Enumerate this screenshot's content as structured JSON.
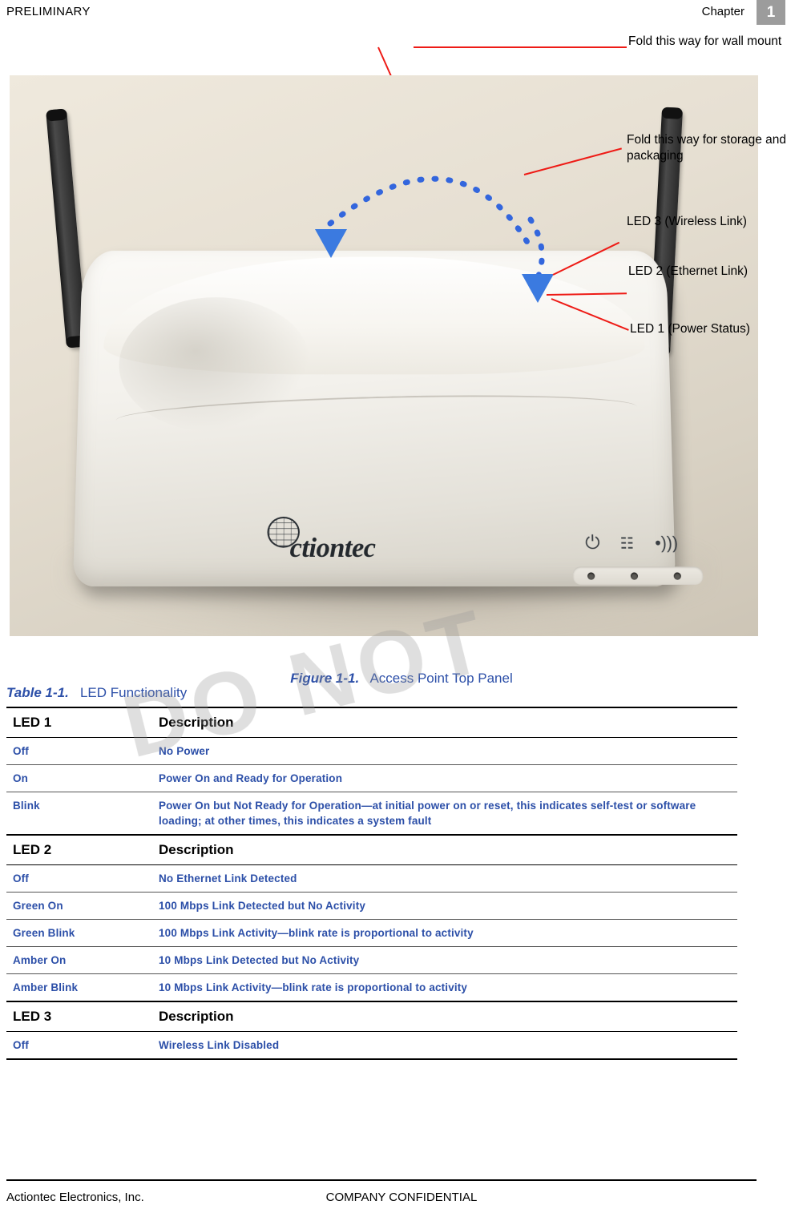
{
  "header": {
    "left_label": "PRELIMINARY",
    "chapter_label": "Chapter",
    "chapter_number": "1"
  },
  "figure": {
    "callouts": [
      {
        "id": "fold-wall",
        "text": "Fold this way for wall mount"
      },
      {
        "id": "fold-storage",
        "text": "Fold this way for storage and packaging"
      },
      {
        "id": "led3",
        "text": "LED 3 (Wireless Link)"
      },
      {
        "id": "led2",
        "text": "LED 2 (Ethernet Link)"
      },
      {
        "id": "led1",
        "text": "LED 1 (Power Status)"
      }
    ],
    "device_logo": "ctiontec",
    "icons": {
      "power": "power-icon",
      "ethernet": "ethernet-icon",
      "wireless": "wireless-icon"
    },
    "caption_label": "Figure 1-1.",
    "caption_text": "Access Point Top Panel"
  },
  "table": {
    "caption_label": "Table 1-1.",
    "caption_text": "LED Functionality",
    "sections": [
      {
        "header": [
          "LED 1",
          "Description"
        ],
        "rows": [
          [
            "Off",
            "No Power"
          ],
          [
            "On",
            "Power On and Ready for Operation"
          ],
          [
            "Blink",
            "Power On but Not Ready for Operation—at initial power on or reset, this indicates self-test or software loading; at other times, this indicates a system fault"
          ]
        ]
      },
      {
        "header": [
          "LED 2",
          "Description"
        ],
        "rows": [
          [
            "Off",
            "No Ethernet Link Detected"
          ],
          [
            "Green On",
            "100 Mbps Link Detected but No Activity"
          ],
          [
            "Green Blink",
            "100 Mbps Link Activity—blink rate is proportional to activity"
          ],
          [
            "Amber On",
            "10 Mbps Link Detected but No Activity"
          ],
          [
            "Amber Blink",
            "10 Mbps Link Activity—blink rate is proportional to activity"
          ]
        ]
      },
      {
        "header": [
          "LED 3",
          "Description"
        ],
        "rows": [
          [
            "Off",
            "Wireless Link Disabled"
          ]
        ]
      }
    ]
  },
  "watermark": {
    "text": "DO NOT"
  },
  "footer": {
    "left": "Actiontec Electronics, Inc.",
    "center": "COMPANY CONFIDENTIAL"
  },
  "colors": {
    "accent_blue": "#2c4fa8",
    "callout_red": "#ee1b16",
    "arrow_blue": "#3366dd",
    "header_box": "#9c9c9c"
  }
}
